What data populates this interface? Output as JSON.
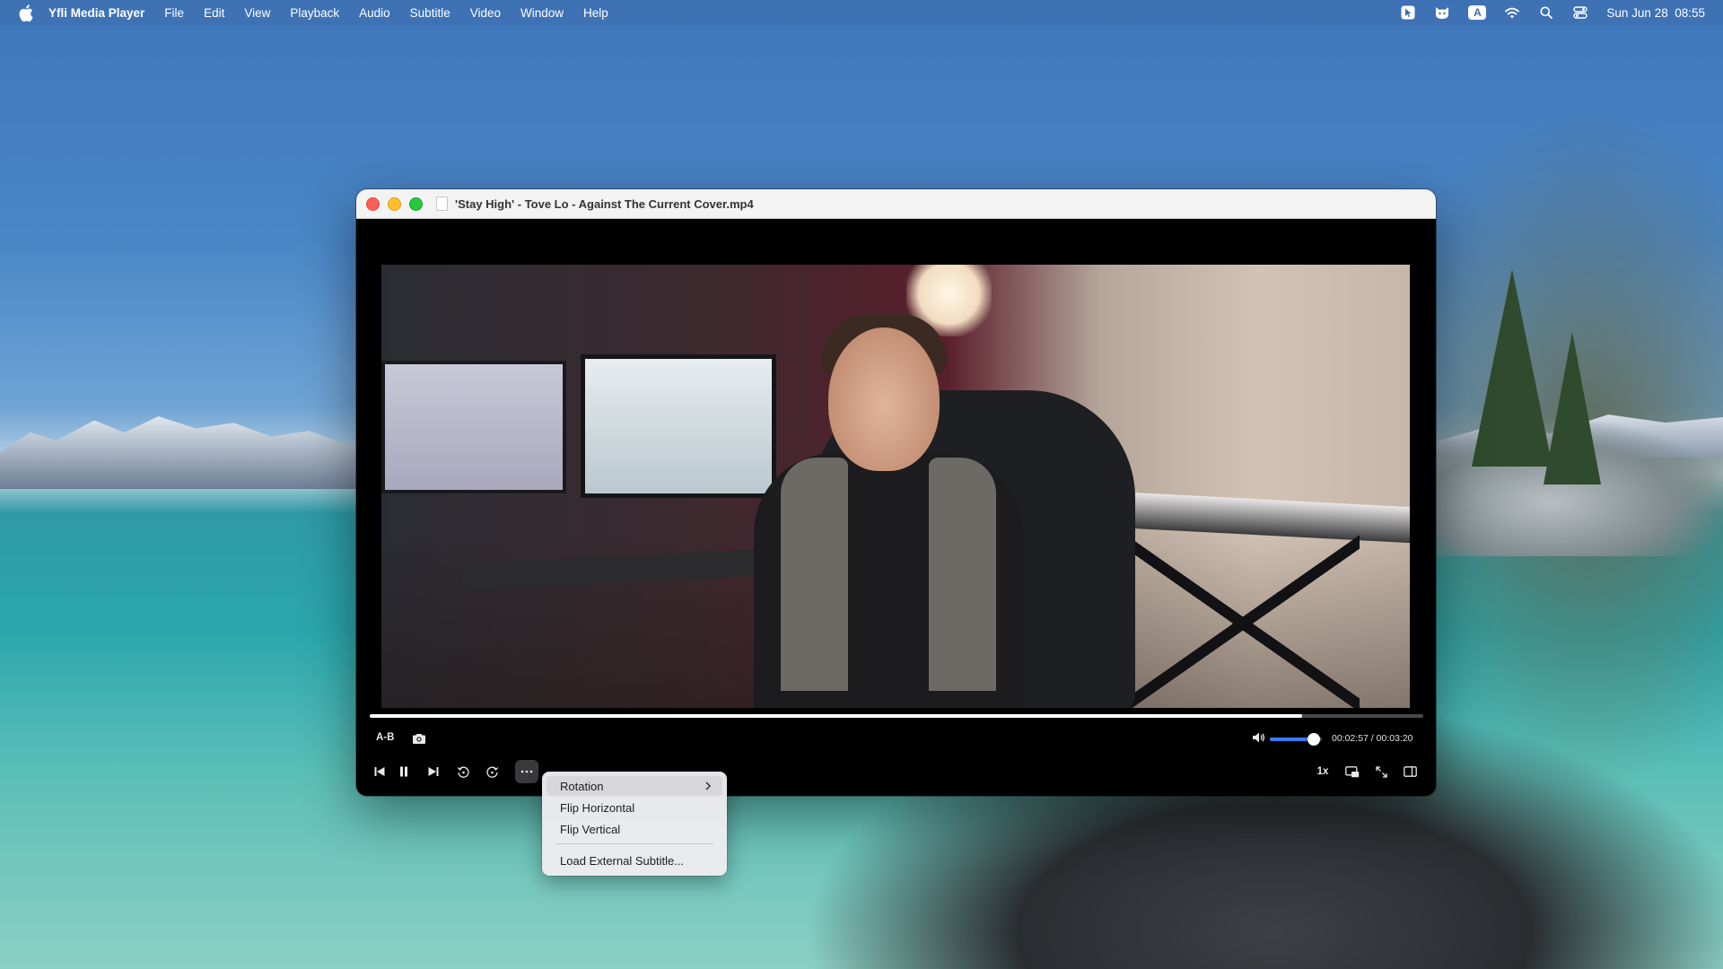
{
  "menubar": {
    "app_name": "Yfli Media Player",
    "items": [
      "File",
      "Edit",
      "View",
      "Playback",
      "Audio",
      "Subtitle",
      "Video",
      "Window",
      "Help"
    ],
    "keyboard_input": "A",
    "clock": "Sun Jun 28  08:55",
    "status_icons": [
      "pointer-app-icon",
      "cat-app-icon",
      "input-source-icon",
      "wifi-icon",
      "spotlight-search-icon",
      "control-center-icon"
    ]
  },
  "window": {
    "title": "'Stay High' - Tove Lo - Against The Current Cover.mp4"
  },
  "player": {
    "ab_label": "A-B",
    "progress_fraction": 0.885,
    "volume_fraction": 0.85,
    "time_current": "00:02:57",
    "time_separator": " / ",
    "time_total": "00:03:20",
    "speed": "1x",
    "colors": {
      "volume_accent": "#3a7bf3"
    }
  },
  "context_menu": {
    "items": [
      {
        "label": "Rotation",
        "has_submenu": true
      },
      {
        "label": "Flip Horizontal"
      },
      {
        "label": "Flip Vertical"
      },
      {
        "label": "Load External Subtitle..."
      }
    ]
  }
}
